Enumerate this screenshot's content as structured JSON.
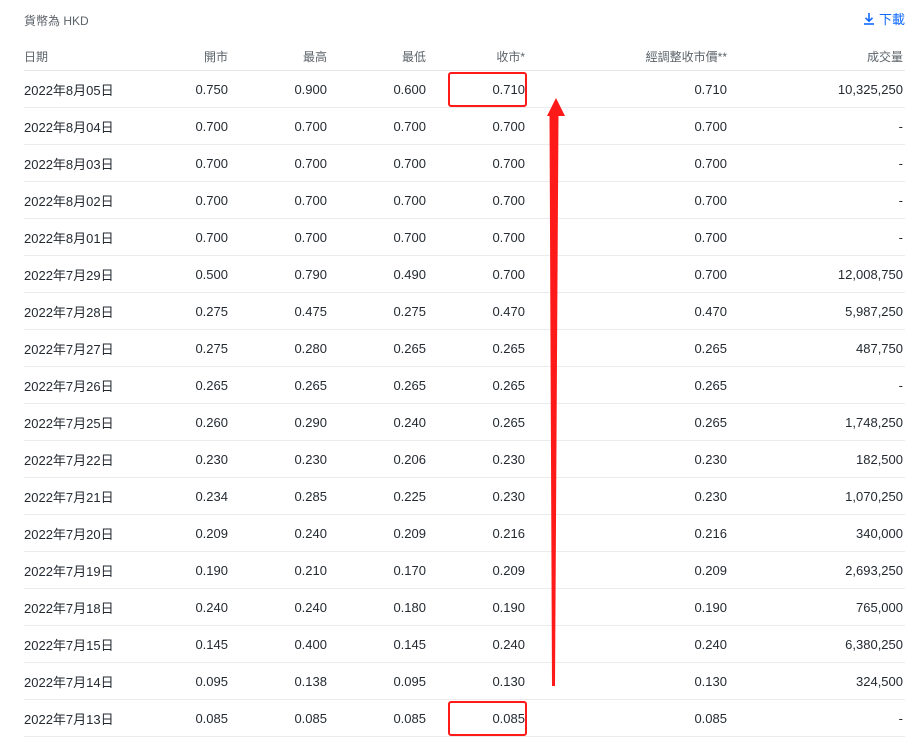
{
  "currency_note": "貨幣為 HKD",
  "download": {
    "label": "下載",
    "icon": "download-arrow-icon"
  },
  "table": {
    "columns": [
      "日期",
      "開市",
      "最高",
      "最低",
      "收市*",
      "經調整收市價**",
      "成交量"
    ],
    "rows": [
      [
        "2022年8月05日",
        "0.750",
        "0.900",
        "0.600",
        "0.710",
        "0.710",
        "10,325,250"
      ],
      [
        "2022年8月04日",
        "0.700",
        "0.700",
        "0.700",
        "0.700",
        "0.700",
        "-"
      ],
      [
        "2022年8月03日",
        "0.700",
        "0.700",
        "0.700",
        "0.700",
        "0.700",
        "-"
      ],
      [
        "2022年8月02日",
        "0.700",
        "0.700",
        "0.700",
        "0.700",
        "0.700",
        "-"
      ],
      [
        "2022年8月01日",
        "0.700",
        "0.700",
        "0.700",
        "0.700",
        "0.700",
        "-"
      ],
      [
        "2022年7月29日",
        "0.500",
        "0.790",
        "0.490",
        "0.700",
        "0.700",
        "12,008,750"
      ],
      [
        "2022年7月28日",
        "0.275",
        "0.475",
        "0.275",
        "0.470",
        "0.470",
        "5,987,250"
      ],
      [
        "2022年7月27日",
        "0.275",
        "0.280",
        "0.265",
        "0.265",
        "0.265",
        "487,750"
      ],
      [
        "2022年7月26日",
        "0.265",
        "0.265",
        "0.265",
        "0.265",
        "0.265",
        "-"
      ],
      [
        "2022年7月25日",
        "0.260",
        "0.290",
        "0.240",
        "0.265",
        "0.265",
        "1,748,250"
      ],
      [
        "2022年7月22日",
        "0.230",
        "0.230",
        "0.206",
        "0.230",
        "0.230",
        "182,500"
      ],
      [
        "2022年7月21日",
        "0.234",
        "0.285",
        "0.225",
        "0.230",
        "0.230",
        "1,070,250"
      ],
      [
        "2022年7月20日",
        "0.209",
        "0.240",
        "0.209",
        "0.216",
        "0.216",
        "340,000"
      ],
      [
        "2022年7月19日",
        "0.190",
        "0.210",
        "0.170",
        "0.209",
        "0.209",
        "2,693,250"
      ],
      [
        "2022年7月18日",
        "0.240",
        "0.240",
        "0.180",
        "0.190",
        "0.190",
        "765,000"
      ],
      [
        "2022年7月15日",
        "0.145",
        "0.400",
        "0.145",
        "0.240",
        "0.240",
        "6,380,250"
      ],
      [
        "2022年7月14日",
        "0.095",
        "0.138",
        "0.095",
        "0.130",
        "0.130",
        "324,500"
      ],
      [
        "2022年7月13日",
        "0.085",
        "0.085",
        "0.085",
        "0.085",
        "0.085",
        "-"
      ]
    ]
  },
  "annotations": {
    "color": "#ff1a1a",
    "highlighted_cells": [
      "0.710",
      "0.085"
    ]
  }
}
